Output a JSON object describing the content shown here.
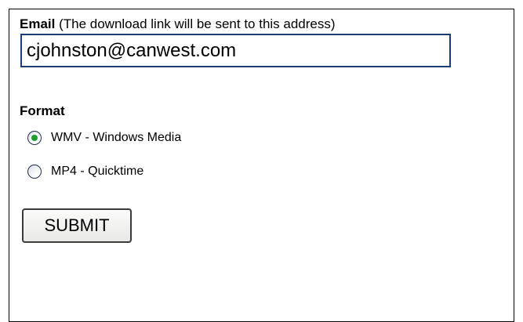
{
  "form": {
    "email": {
      "label_bold": "Email",
      "label_note": " (The download link will be sent to this address)",
      "value": "cjohnston@canwest.com"
    },
    "format": {
      "label": "Format",
      "options": [
        {
          "label": "WMV - Windows Media",
          "selected": true
        },
        {
          "label": "MP4 - Quicktime",
          "selected": false
        }
      ]
    },
    "submit_label": "SUBMIT"
  },
  "colors": {
    "input_border": "#1c3c74",
    "radio_selected_dot": "#1e9e2f"
  },
  "icons": {
    "radio_selected": "radio-selected-icon",
    "radio_unselected": "radio-unselected-icon"
  }
}
